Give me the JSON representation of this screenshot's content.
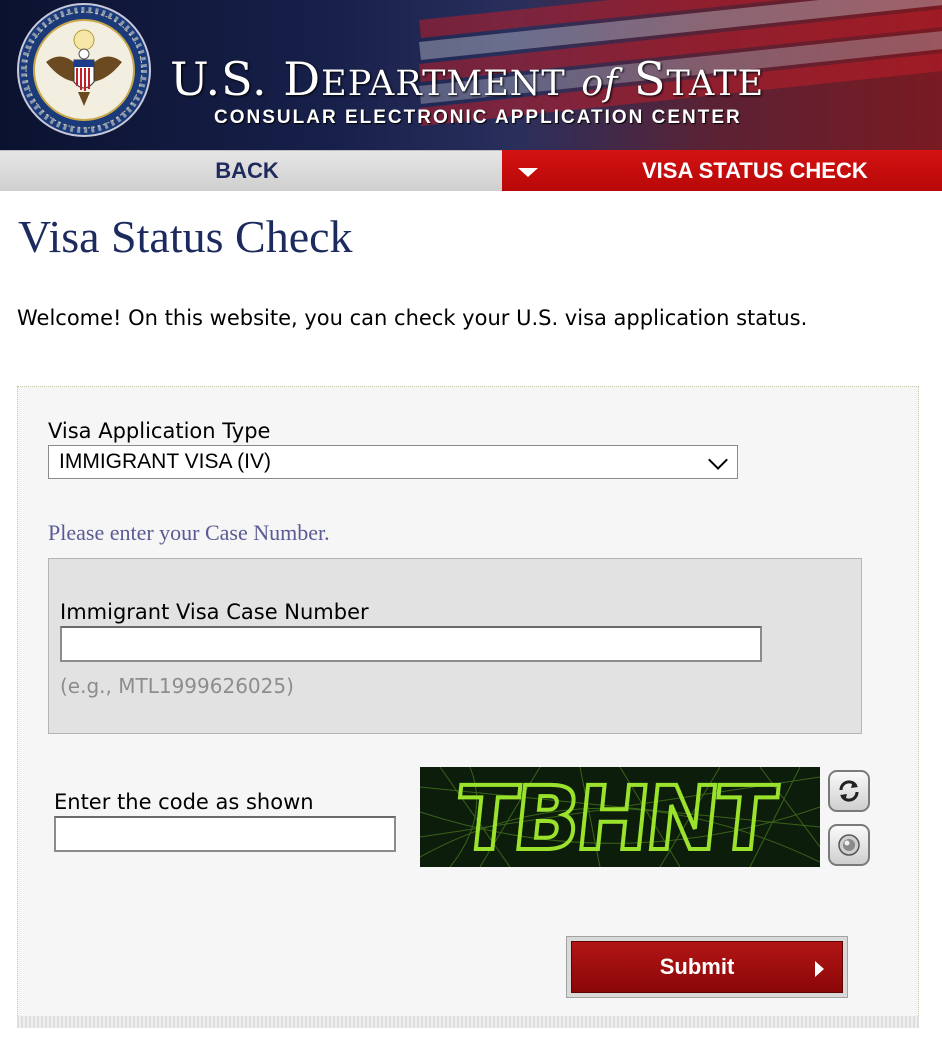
{
  "header": {
    "title_u": "U.S. D",
    "title_epartment": "EPARTMENT",
    "title_of": "of",
    "title_s": "S",
    "title_tate": "TATE",
    "subtitle": "CONSULAR ELECTRONIC APPLICATION CENTER",
    "seal_icon": "department-of-state-seal-icon",
    "seal_ring_text": "DEPARTMENT OF STATE • UNITED STATES OF AMERICA"
  },
  "nav": {
    "back_label": "BACK",
    "status_label": "VISA STATUS CHECK",
    "status_icon": "caret-down-icon"
  },
  "page": {
    "title": "Visa Status Check",
    "welcome": "Welcome! On this website, you can check your U.S. visa application status."
  },
  "form": {
    "visa_type_label": "Visa Application Type",
    "visa_type_value": "IMMIGRANT VISA (IV)",
    "case_prompt": "Please enter your Case Number.",
    "case_number_label": "Immigrant Visa Case Number",
    "case_number_value": "",
    "case_number_example": "(e.g., MTL1999626025)",
    "captcha_label": "Enter the code as shown",
    "captcha_value": "",
    "captcha_text": "TBHNT",
    "refresh_icon": "refresh-icon",
    "audio_icon": "audio-speaker-icon",
    "submit_label": "Submit",
    "submit_icon": "arrow-right-icon"
  },
  "colors": {
    "navy": "#1d2a5e",
    "nav_red": "#c80c0c",
    "submit_red": "#9e0e0e",
    "prompt_purple": "#5a5a94",
    "captcha_green": "#9ae22c"
  }
}
